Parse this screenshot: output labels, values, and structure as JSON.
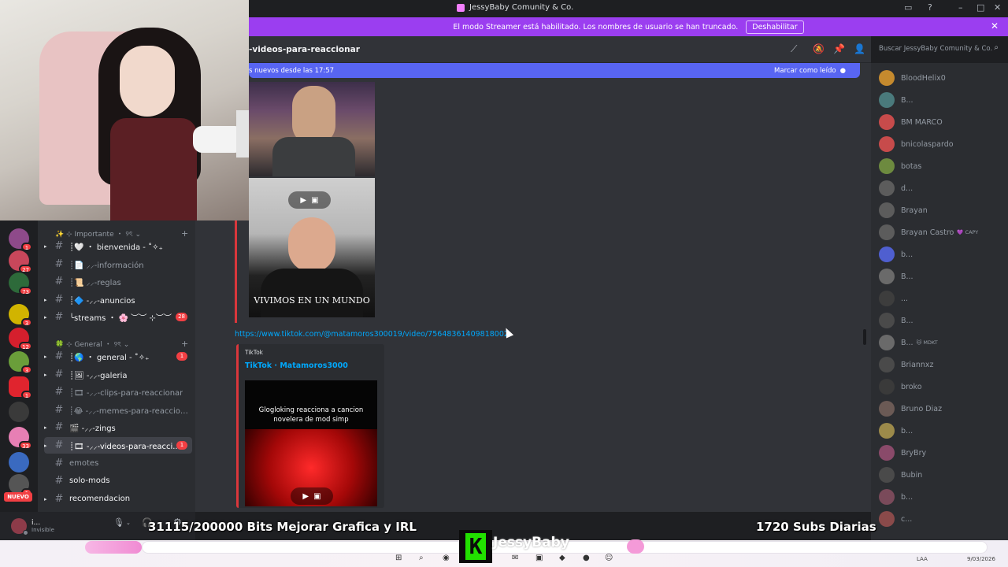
{
  "window": {
    "title": "JessyBaby Comunity & Co.",
    "controls": [
      "▭",
      "?",
      "–",
      "□",
      "✕"
    ]
  },
  "banner": {
    "message": "El modo Streamer está habilitado. Los nombres de usuario se han truncado.",
    "button": "Deshabilitar",
    "close": "✕"
  },
  "channel_header": {
    "title": "-videos-para-reaccionar",
    "icons": [
      "threads-icon",
      "mute-icon",
      "pin-icon",
      "members-icon"
    ]
  },
  "search": {
    "placeholder": "Buscar JessyBaby Comunity & Co."
  },
  "new_messages_bar": {
    "text": "s nuevos desde las 17:57",
    "action": "Marcar como leído"
  },
  "server_rail": {
    "badges": [
      "1",
      "27",
      "73",
      "3",
      "12",
      "3",
      "1",
      "33",
      "1"
    ],
    "nuevo": "NUEVO"
  },
  "categories": [
    {
      "label": "✨ ⊹ Importante ・ ୨ৎ ⌄",
      "plus": "+"
    },
    {
      "label": "🍀 ⊹ General ・ ୨ৎ ⌄",
      "plus": "+"
    }
  ],
  "channels": [
    {
      "name": "┊🤍 ・ bienvenida - ˚✧₊",
      "unread": true,
      "arrow": "▸"
    },
    {
      "name": "┊📄 ⸝⸝-información",
      "unread": false,
      "arrow": ""
    },
    {
      "name": "┊📜 ⸝⸝-reglas",
      "unread": false,
      "arrow": ""
    },
    {
      "name": "┊🔷 -⸝⸝-anuncios",
      "unread": true,
      "arrow": "▸"
    },
    {
      "name": "╰streams ・ 🌸 ︶︶ ⊹︶︶",
      "unread": true,
      "arrow": "▸",
      "count": "28"
    },
    {
      "name": "┊🌎 ・ general - ˚✧₊",
      "unread": true,
      "arrow": "▸",
      "count": "1"
    },
    {
      "name": "┊🖼 -⸝⸝-galeria",
      "unread": true,
      "arrow": "▸"
    },
    {
      "name": "┊🎞 -⸝⸝-clips-para-reaccionar",
      "unread": false,
      "arrow": ""
    },
    {
      "name": "┊😂 -⸝⸝-memes-para-reaccionar",
      "unread": false,
      "arrow": ""
    },
    {
      "name": "🎬 -⸝⸝-zings",
      "unread": true,
      "arrow": "▸"
    },
    {
      "name": "┊🎞 -⸝⸝-videos-para-reacci...",
      "unread": true,
      "arrow": "▸",
      "count": "1",
      "active": true
    },
    {
      "name": "emotes",
      "unread": false,
      "arrow": ""
    },
    {
      "name": "solo-mods",
      "unread": true,
      "arrow": ""
    },
    {
      "name": "recomendacion",
      "unread": true,
      "arrow": "▸"
    }
  ],
  "user_panel": {
    "name": "i...",
    "status": "Invisible"
  },
  "messages": {
    "video_caption": "VIVIMOS EN UN MUNDO",
    "link": "https://www.tiktok.com/@matamoros300019/video/75648361409818002",
    "embed_provider": "TikTok",
    "embed_title": "TikTok · Matamoros3000",
    "embed_caption": "Glogloking reacciona a cancion novelera de mod simp"
  },
  "members": [
    {
      "name": "BloodHelix0",
      "color": "#c58a2e"
    },
    {
      "name": "B...",
      "color": "#4a7a7c"
    },
    {
      "name": "BM MARCO",
      "color": "#c74b4b"
    },
    {
      "name": "bnicolaspardo",
      "color": "#c74b4b"
    },
    {
      "name": "botas",
      "color": "#6d8a3f"
    },
    {
      "name": "d...",
      "color": "#5c5c5c"
    },
    {
      "name": "Brayan",
      "color": "#5c5c5c"
    },
    {
      "name": "Brayan Castro",
      "color": "#5c5c5c",
      "tag": "💜 CAPY"
    },
    {
      "name": "b...",
      "color": "#4f5fd0"
    },
    {
      "name": "B...",
      "color": "#6a6a6a"
    },
    {
      "name": "...",
      "color": "#3d3d3d"
    },
    {
      "name": "B...",
      "color": "#4a4a4a"
    },
    {
      "name": "B...",
      "color": "#6a6a6a",
      "tag": "🐱 MDKT"
    },
    {
      "name": "Briannxz",
      "color": "#4a4a4a"
    },
    {
      "name": "broko",
      "color": "#3a3a3a"
    },
    {
      "name": "Bruno Diaz",
      "color": "#6b5a55"
    },
    {
      "name": "b...",
      "color": "#9c8a4a"
    },
    {
      "name": "BryBry",
      "color": "#8a4a6a"
    },
    {
      "name": "Bubin",
      "color": "#4a4a4a"
    },
    {
      "name": "b...",
      "color": "#7a4a5a"
    },
    {
      "name": "c...",
      "color": "#8a4a4a"
    }
  ],
  "stream_overlay": {
    "bits_goal": "31115/200000 Bits Mejorar Grafica y IRL",
    "subs": "1720 Subs Diarias",
    "brand": "JessyBaby",
    "k": "K"
  },
  "taskbar": {
    "lang": "LAA",
    "date": "9/03/2026"
  }
}
